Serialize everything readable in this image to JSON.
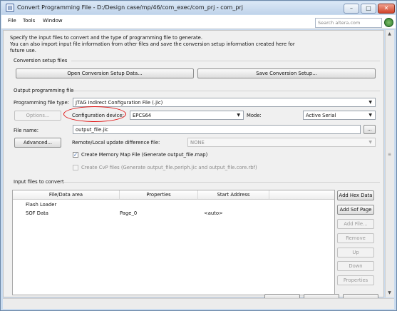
{
  "window": {
    "title": "Convert Programming File - D:/Design case/mp/46/com_exec/com_prj - com_prj",
    "app_icon": "document-icon",
    "controls": [
      "minimize",
      "maximize",
      "close"
    ]
  },
  "menu": {
    "items": [
      "File",
      "Tools",
      "Window"
    ],
    "search_placeholder": "Search altera.com"
  },
  "intro": {
    "line1": "Specify the input files to convert and the type of programming file to generate.",
    "line2": "You can also import input file information from other files and save the conversion setup information created here for",
    "line3": "future use."
  },
  "conversion_setup": {
    "label": "Conversion setup files",
    "open_button": "Open Conversion Setup Data...",
    "save_button": "Save Conversion Setup..."
  },
  "output": {
    "label": "Output programming file",
    "file_type_label": "Programming file type:",
    "file_type_value": "JTAG Indirect Configuration File (.jic)",
    "options_button": "Options...",
    "config_device_label": "Configuration device:",
    "config_device_value": "EPCS64",
    "mode_label": "Mode:",
    "mode_value": "Active Serial",
    "file_name_label": "File name:",
    "file_name_value": "output_file.jic",
    "browse_button": "...",
    "advanced_button": "Advanced...",
    "remote_label": "Remote/Local update difference file:",
    "remote_value": "NONE",
    "memory_map_label": "Create Memory Map File (Generate output_file.map)",
    "memory_map_checked": true,
    "cvp_label": "Create CvP files (Generate output_file.periph.jic and output_file.core.rbf)",
    "cvp_checked": false
  },
  "input_files": {
    "label": "Input files to convert",
    "columns": [
      "File/Data area",
      "Properties",
      "Start Address"
    ],
    "rows": [
      {
        "file": "Flash Loader",
        "properties": "",
        "address": ""
      },
      {
        "file": "SOF Data",
        "properties": "Page_0",
        "address": "<auto>"
      }
    ],
    "buttons": {
      "add_hex": "Add Hex Data",
      "add_sof": "Add Sof Page",
      "add_file": "Add File...",
      "remove": "Remove",
      "up": "Up",
      "down": "Down",
      "properties": "Properties"
    }
  }
}
